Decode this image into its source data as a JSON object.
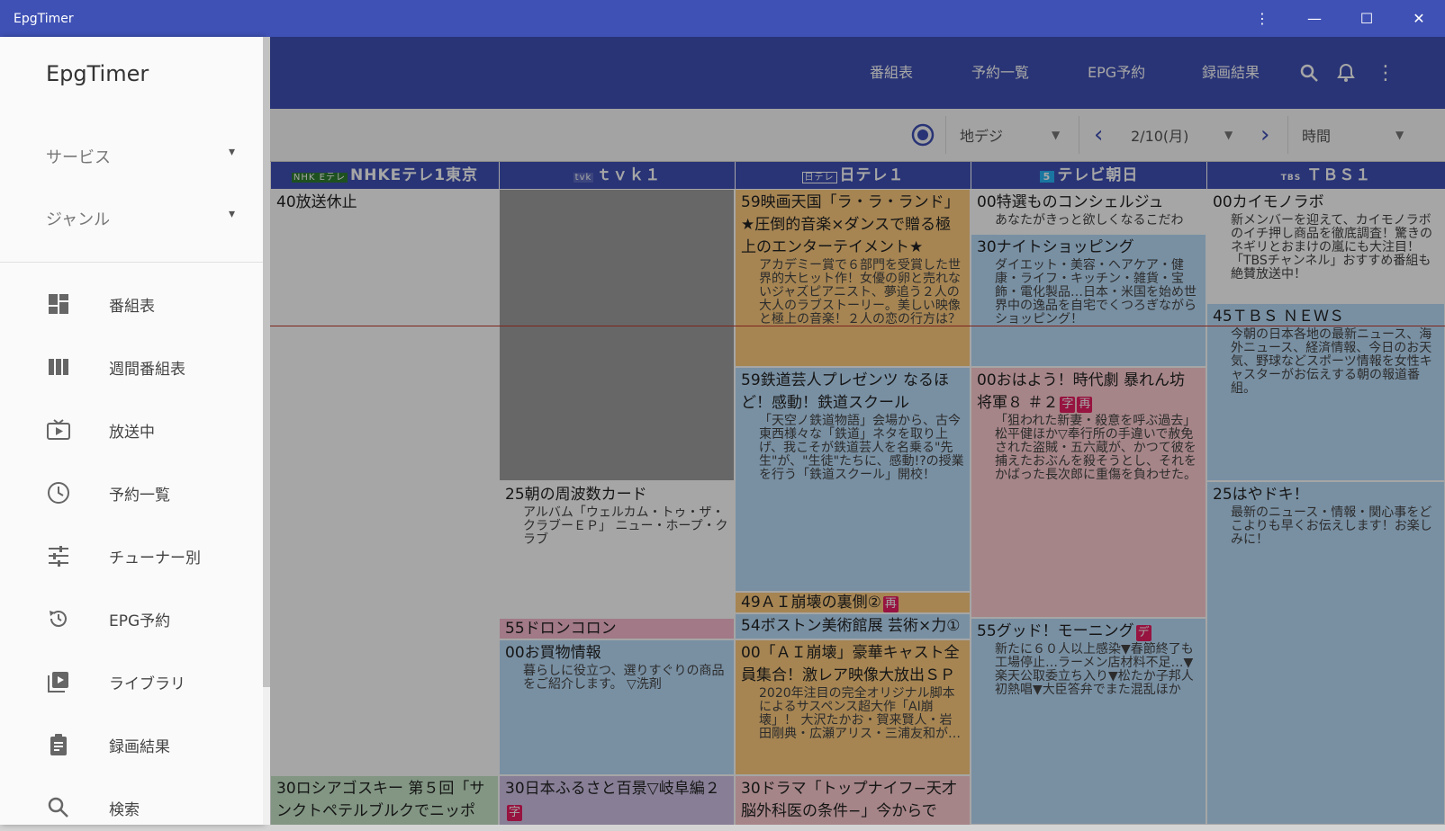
{
  "window": {
    "title": "EpgTimer"
  },
  "appbar": {
    "nav": [
      "番組表",
      "予約一覧",
      "EPG予約",
      "録画結果"
    ],
    "icons": [
      "search-icon",
      "bell-icon",
      "more-vert-icon"
    ]
  },
  "toolbar": {
    "source": "地デジ",
    "date": "2/10(月)",
    "sort": "時間",
    "prev_icon": "‹",
    "next_icon": "›"
  },
  "channels": [
    {
      "logo": "NHK Eテレ",
      "name": "NHKEテレ1東京"
    },
    {
      "logo": "tvk",
      "name": "ｔｖｋ１"
    },
    {
      "logo": "日テレ",
      "name": "日テレ１"
    },
    {
      "logo": "5",
      "name": "テレビ朝日"
    },
    {
      "logo": "TBS",
      "name": "ＴＢＳ１"
    }
  ],
  "programs": {
    "c0": [
      {
        "title": "40放送休止",
        "desc": ""
      },
      {
        "title": "30ロシアゴスキー 第５回「サンクトペテルブルクでニッポ",
        "desc": ""
      }
    ],
    "c1": [
      {
        "title": "25朝の周波数カード",
        "desc": "アルバム「ウェルカム・トゥ・ザ・クラブーＥＰ」 ニュー・ホープ・クラブ"
      },
      {
        "title": "55ドロンコロン",
        "desc": ""
      },
      {
        "title": "00お買物情報",
        "desc": "暮らしに役立つ、選りすぐりの商品をご紹介します。 ▽洗剤"
      },
      {
        "title": "30日本ふるさと百景▽岐阜編２",
        "desc": "",
        "badge": "字"
      }
    ],
    "c2": [
      {
        "title": "59映画天国「ラ・ラ・ランド」★圧倒的音楽×ダンスで贈る極上のエンターテイメント★",
        "desc": "アカデミー賞で６部門を受賞した世界的大ヒット作！女優の卵と売れないジャズピアニスト、夢追う２人の大人のラブストーリー。美しい映像と極上の音楽！２人の恋の行方は？"
      },
      {
        "title": "59鉄道芸人プレゼンツ なるほど！感動！鉄道スクール",
        "desc": "「天空ノ鉄道物語」会場から、古今東西様々な「鉄道」ネタを取り上げ、我こそが鉄道芸人を名乗る\"先生\"が、\"生徒\"たちに、感動!?の授業を行う「鉄道スクール」開校！"
      },
      {
        "title": "49ＡＩ崩壊の裏側②",
        "desc": "",
        "badge": "再"
      },
      {
        "title": "54ボストン美術館展 芸術×力①",
        "desc": ""
      },
      {
        "title": "00「ＡＩ崩壊」豪華キャスト全員集合！激レア映像大放出ＳＰ",
        "desc": "2020年注目の完全オリジナル脚本によるサスペンス超大作「AI崩壊」！ 大沢たかお・賀来賢人・岩田剛典・広瀬アリス・三浦友和が…"
      },
      {
        "title": "30ドラマ「トップナイフ−天才脳外科医の条件−」今からで",
        "desc": ""
      }
    ],
    "c3": [
      {
        "title": "00特選ものコンシェルジュ",
        "desc": "あなたがきっと欲しくなるこだわ"
      },
      {
        "title": "30ナイトショッピング",
        "desc": "ダイエット・美容・ヘアケア・健康・ライフ・キッチン・雑貨・宝飾・電化製品…日本・米国を始め世界中の逸品を自宅でくつろぎながらショッピング！"
      },
      {
        "title": "00おはよう！時代劇 暴れん坊将軍８ ＃２",
        "desc": "「狙われた新妻・殺意を呼ぶ過去」松平健ほか▽奉行所の手違いで赦免された盗賊・五六蔵が、かつて彼を捕えたおぶんを殺そうとし、それをかばった長次郎に重傷を負わせた。",
        "badge": "字",
        "badge2": "再"
      },
      {
        "title": "55グッド！モーニング",
        "desc": "新たに６０人以上感染▼春節終了も工場停止…ラーメン店材料不足…▼楽天公取委立ち入り▼松たか子邦人初熱唱▼大臣答弁でまた混乱ほか",
        "badge": "デ"
      }
    ],
    "c4": [
      {
        "title": "00カイモノラボ",
        "desc": "新メンバーを迎えて、カイモノラボのイチ押し商品を徹底調査！驚きのネギリとおまけの嵐にも大注目！ 「TBSチャンネル」おすすめ番組も絶賛放送中！"
      },
      {
        "title": "45ＴＢＳ ＮＥＷＳ",
        "desc": "今朝の日本各地の最新ニュース、海外ニュース、経済情報、今日のお天気、野球などスポーツ情報を女性キャスターがお伝えする朝の報道番組。"
      },
      {
        "title": "25はやドキ！",
        "desc": "最新のニュース・情報・関心事をどこよりも早くお伝えします！お楽しみに！"
      }
    ]
  },
  "drawer": {
    "title": "EpgTimer",
    "filters": [
      "サービス",
      "ジャンル"
    ],
    "items": [
      {
        "label": "番組表",
        "icon": "dashboard-icon"
      },
      {
        "label": "週間番組表",
        "icon": "columns-icon"
      },
      {
        "label": "放送中",
        "icon": "live-tv-icon"
      },
      {
        "label": "予約一覧",
        "icon": "clock-icon"
      },
      {
        "label": "チューナー別",
        "icon": "tune-icon"
      },
      {
        "label": "EPG予約",
        "icon": "history-icon"
      },
      {
        "label": "ライブラリ",
        "icon": "video-library-icon"
      },
      {
        "label": "録画結果",
        "icon": "assignment-icon"
      },
      {
        "label": "検索",
        "icon": "search-icon"
      }
    ]
  },
  "colors": {
    "primary": "#3f51b5",
    "orange": "#ffcc80",
    "blue": "#bbdefb",
    "pink": "#f8bbd0",
    "red": "#ffcdd2",
    "green": "#c8e6c9",
    "gray": "#9e9e9e",
    "white": "#ffffff",
    "purple": "#d1c4e9",
    "badge": "#e91e63"
  }
}
